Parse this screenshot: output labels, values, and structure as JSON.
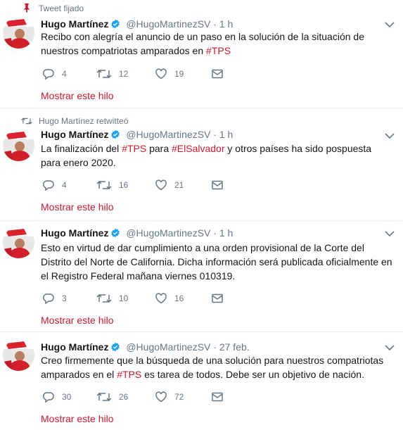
{
  "colors": {
    "accent": "#c71a2e",
    "muted": "#657786",
    "text": "#14171a",
    "verified": "#1da1f2",
    "divider": "#e6ecf0"
  },
  "tweets": [
    {
      "context": "Tweet fijado",
      "context_icon": "pin-icon",
      "name": "Hugo Martínez",
      "handle": "@HugoMartinezSV",
      "dot": "·",
      "time": "1 h",
      "text_parts": [
        {
          "t": "Recibo con alegría el anuncio de un paso en la solución de la situación de nuestros compatriotas amparados en ",
          "tag": false
        },
        {
          "t": "#TPS",
          "tag": true
        }
      ],
      "replies": "4",
      "retweets": "12",
      "likes": "19",
      "show_thread": "Mostrar este hilo"
    },
    {
      "context": "Hugo Martínez retwitteó",
      "context_icon": "retweet-icon",
      "name": "Hugo Martínez",
      "handle": "@HugoMartinezSV",
      "dot": "·",
      "time": "1 h",
      "text_parts": [
        {
          "t": "La finalización del ",
          "tag": false
        },
        {
          "t": "#TPS",
          "tag": true
        },
        {
          "t": " para ",
          "tag": false
        },
        {
          "t": "#ElSalvador",
          "tag": true
        },
        {
          "t": " y otros países ha sido pospuesta para enero 2020.",
          "tag": false
        }
      ],
      "replies": "4",
      "retweets": "16",
      "likes": "21",
      "show_thread": "Mostrar este hilo"
    },
    {
      "context": "",
      "name": "Hugo Martínez",
      "handle": "@HugoMartinezSV",
      "dot": "·",
      "time": "1 h",
      "text_parts": [
        {
          "t": "Esto en virtud de dar cumplimiento a una orden provisional de la Corte del Distrito del Norte de California. Dicha información será publicada oficialmente en el Registro Federal mañana viernes 010319.",
          "tag": false
        }
      ],
      "replies": "3",
      "retweets": "10",
      "likes": "16",
      "show_thread": "Mostrar este hilo"
    },
    {
      "context": "",
      "name": "Hugo Martínez",
      "handle": "@HugoMartinezSV",
      "dot": "·",
      "time": "27 feb.",
      "text_parts": [
        {
          "t": "Creo firmemente que la búsqueda de una solución para nuestros compatriotas amparados en el ",
          "tag": false
        },
        {
          "t": "#TPS",
          "tag": true
        },
        {
          "t": " es tarea de todos. Debe ser un objetivo de nación.",
          "tag": false
        }
      ],
      "replies": "30",
      "retweets": "26",
      "likes": "72",
      "show_thread": "Mostrar este hilo"
    }
  ]
}
